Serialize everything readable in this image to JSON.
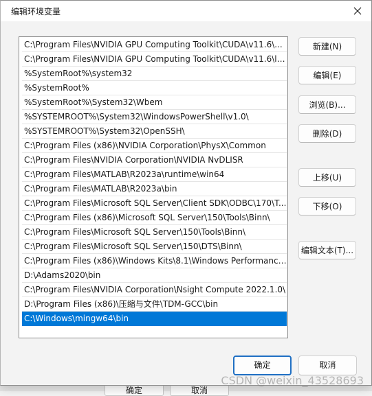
{
  "dialog": {
    "title": "编辑环境变量",
    "close_icon": "close-icon"
  },
  "paths": [
    "C:\\Program Files\\NVIDIA GPU Computing Toolkit\\CUDA\\v11.6\\...",
    "C:\\Program Files\\NVIDIA GPU Computing Toolkit\\CUDA\\v11.6\\li...",
    "%SystemRoot%\\system32",
    "%SystemRoot%",
    "%SystemRoot%\\System32\\Wbem",
    "%SYSTEMROOT%\\System32\\WindowsPowerShell\\v1.0\\",
    "%SYSTEMROOT%\\System32\\OpenSSH\\",
    "C:\\Program Files (x86)\\NVIDIA Corporation\\PhysX\\Common",
    "C:\\Program Files\\NVIDIA Corporation\\NVIDIA NvDLISR",
    "C:\\Program Files\\MATLAB\\R2023a\\runtime\\win64",
    "C:\\Program Files\\MATLAB\\R2023a\\bin",
    "C:\\Program Files\\Microsoft SQL Server\\Client SDK\\ODBC\\170\\T...",
    "C:\\Program Files (x86)\\Microsoft SQL Server\\150\\Tools\\Binn\\",
    "C:\\Program Files\\Microsoft SQL Server\\150\\Tools\\Binn\\",
    "C:\\Program Files\\Microsoft SQL Server\\150\\DTS\\Binn\\",
    "C:\\Program Files (x86)\\Windows Kits\\8.1\\Windows Performance...",
    "D:\\Adams2020\\bin",
    "C:\\Program Files\\NVIDIA Corporation\\Nsight Compute 2022.1.0\\",
    "D:\\Program Files (x86)\\压缩与文件\\TDM-GCC\\bin",
    "C:\\Windows\\mingw64\\bin"
  ],
  "selected_index": 19,
  "buttons": {
    "new": "新建(N)",
    "edit": "编辑(E)",
    "browse": "浏览(B)...",
    "delete": "删除(D)",
    "move_up": "上移(U)",
    "move_down": "下移(O)",
    "edit_text": "编辑文本(T)...",
    "ok": "确定",
    "cancel": "取消"
  },
  "background": {
    "left_glyphs": [
      "G",
      "G",
      "G",
      "G",
      "G",
      "ar",
      "w",
      "ar",
      "_l",
      "ar",
      "E"
    ],
    "bottom_buttons": [
      "确定",
      "取消"
    ]
  },
  "watermark": "CSDN @weixin_43528693",
  "colors": {
    "selection": "#0078d7",
    "default_button_border": "#1f6fc3"
  }
}
